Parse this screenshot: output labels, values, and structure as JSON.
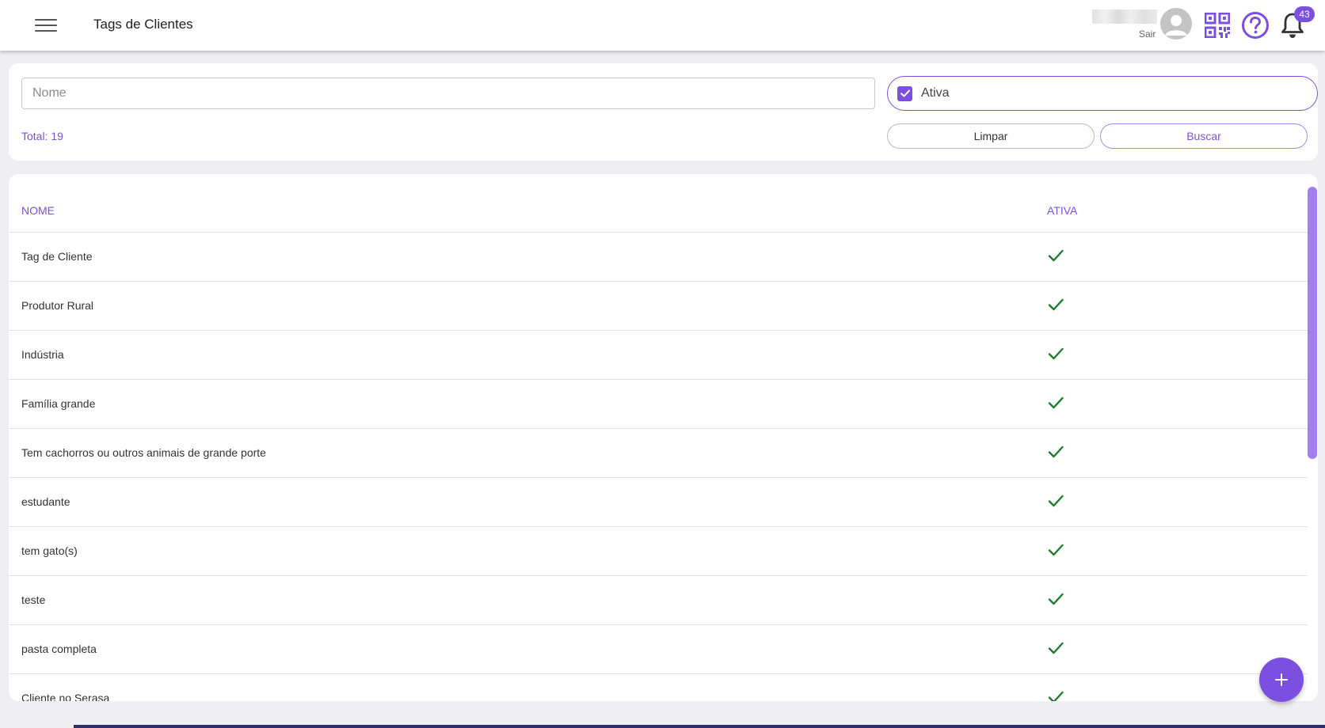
{
  "header": {
    "title": "Tags de Clientes",
    "logout_label": "Sair",
    "notification_count": "43",
    "icons": [
      "menu-icon",
      "avatar-icon",
      "qr-code-icon",
      "help-icon",
      "bell-icon"
    ]
  },
  "filters": {
    "name_placeholder": "Nome",
    "name_value": "",
    "active_label": "Ativa",
    "active_checked": true,
    "total_label": "Total: 19",
    "clear_label": "Limpar",
    "search_label": "Buscar"
  },
  "table": {
    "columns": [
      "NOME",
      "ATIVA"
    ],
    "rows": [
      {
        "name": "Tag de Cliente",
        "active": true
      },
      {
        "name": "Produtor Rural",
        "active": true
      },
      {
        "name": "Indústria",
        "active": true
      },
      {
        "name": "Família grande",
        "active": true
      },
      {
        "name": "Tem cachorros ou outros animais de grande porte",
        "active": true
      },
      {
        "name": "estudante",
        "active": true
      },
      {
        "name": "tem gato(s)",
        "active": true
      },
      {
        "name": "teste",
        "active": true
      },
      {
        "name": "pasta completa",
        "active": true
      },
      {
        "name": "Cliente no Serasa",
        "active": true
      }
    ]
  },
  "fab": {
    "icon": "plus-icon"
  },
  "colors": {
    "accent": "#7b4fe0",
    "check_green": "#1a7f2a",
    "background": "#efeef3"
  }
}
